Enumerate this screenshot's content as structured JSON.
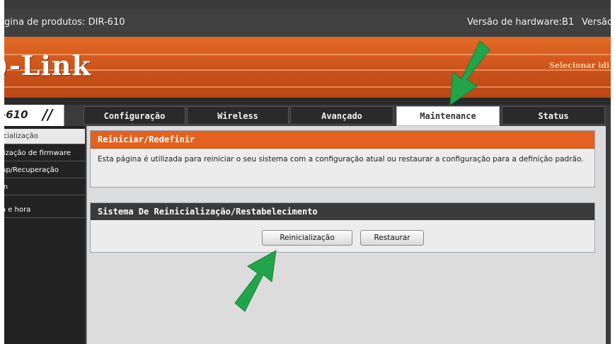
{
  "topbar": {
    "product_page": "ágina de produtos: DIR-610",
    "hardware_version": "Versão de hardware:B1",
    "firmware_version_cut": "Versão"
  },
  "header": {
    "logo_text": ")-Link",
    "language_select": "Selecionar idi"
  },
  "nav": {
    "model": "-610",
    "model_slashes": "//",
    "tabs": [
      {
        "label": "Configuração",
        "active": false
      },
      {
        "label": "Wireless",
        "active": false
      },
      {
        "label": "Avançado",
        "active": false
      },
      {
        "label": "Maintenance",
        "active": true
      },
      {
        "label": "Status",
        "active": false
      }
    ]
  },
  "sidebar": {
    "items": [
      {
        "label": "icialização",
        "active": true
      },
      {
        "label": "lização de firmware",
        "active": false
      },
      {
        "label": "up/Recuperação",
        "active": false
      },
      {
        "label": "in",
        "active": false
      },
      {
        "label": "a e hora",
        "active": false
      }
    ]
  },
  "main": {
    "section1": {
      "title": "Reiniciar/Redefinir",
      "description": "Esta página é utilizada para reiniciar o seu sistema com a configuração atual ou restaurar a configuração para a definição padrão."
    },
    "section2": {
      "title": "Sistema De Reinicialização/Restabelecimento",
      "reboot_button": "Reinicialização",
      "restore_button": "Restaurar"
    }
  },
  "colors": {
    "brand_orange": "#e4611f",
    "annotation_arrow": "#22a54a"
  },
  "icons": [
    "arrow-annotation-icon"
  ]
}
